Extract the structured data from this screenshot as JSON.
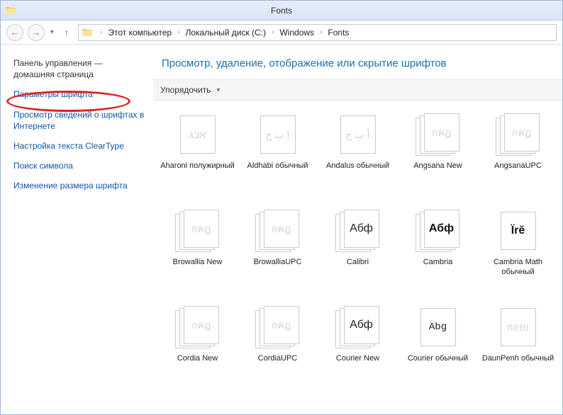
{
  "window": {
    "title": "Fonts"
  },
  "breadcrumbs": {
    "items": [
      "Этот компьютер",
      "Локальный диск (C:)",
      "Windows",
      "Fonts"
    ]
  },
  "sidebar": {
    "links": [
      "Панель управления — домашняя страница",
      "Параметры шрифта",
      "Просмотр сведений о шрифтах в Интернете",
      "Настройка текста ClearType",
      "Поиск символа",
      "Изменение размера шрифта"
    ]
  },
  "page": {
    "header": "Просмотр, удаление, отображение или скрытие шрифтов"
  },
  "toolbar": {
    "arrange": "Упорядочить"
  },
  "fonts": [
    {
      "name": "Aharoni полужирный",
      "sample": "אבג",
      "style": "faint",
      "stacked": false
    },
    {
      "name": "Aldhabi обычный",
      "sample": "ا ب ج",
      "style": "faint",
      "stacked": false
    },
    {
      "name": "Andalus обычный",
      "sample": "أ ب ج",
      "style": "faint",
      "stacked": false
    },
    {
      "name": "Angsana New",
      "sample": "กคฎ",
      "style": "faint",
      "stacked": true
    },
    {
      "name": "AngsanaUPC",
      "sample": "กคฎ",
      "style": "faint",
      "stacked": true
    },
    {
      "name": "Browallia New",
      "sample": "กคฎ",
      "style": "faint",
      "stacked": true
    },
    {
      "name": "BrowalliaUPC",
      "sample": "กคฎ",
      "style": "faint",
      "stacked": true
    },
    {
      "name": "Calibri",
      "sample": "Абф",
      "style": "dark",
      "stacked": true
    },
    {
      "name": "Cambria",
      "sample": "Абф",
      "style": "bold",
      "stacked": true
    },
    {
      "name": "Cambria Math обычный",
      "sample": "Їrĕ",
      "style": "bold",
      "stacked": false
    },
    {
      "name": "Cordia New",
      "sample": "กคฎ",
      "style": "faint",
      "stacked": true
    },
    {
      "name": "CordiaUPC",
      "sample": "กคฎ",
      "style": "faint",
      "stacked": true
    },
    {
      "name": "Courier New",
      "sample": "Абф",
      "style": "dark",
      "stacked": true
    },
    {
      "name": "Courier обычный",
      "sample": "Abg",
      "style": "mono",
      "stacked": false
    },
    {
      "name": "DaunPenh обычный",
      "sample": "កខឃ",
      "style": "faint",
      "stacked": false
    }
  ]
}
